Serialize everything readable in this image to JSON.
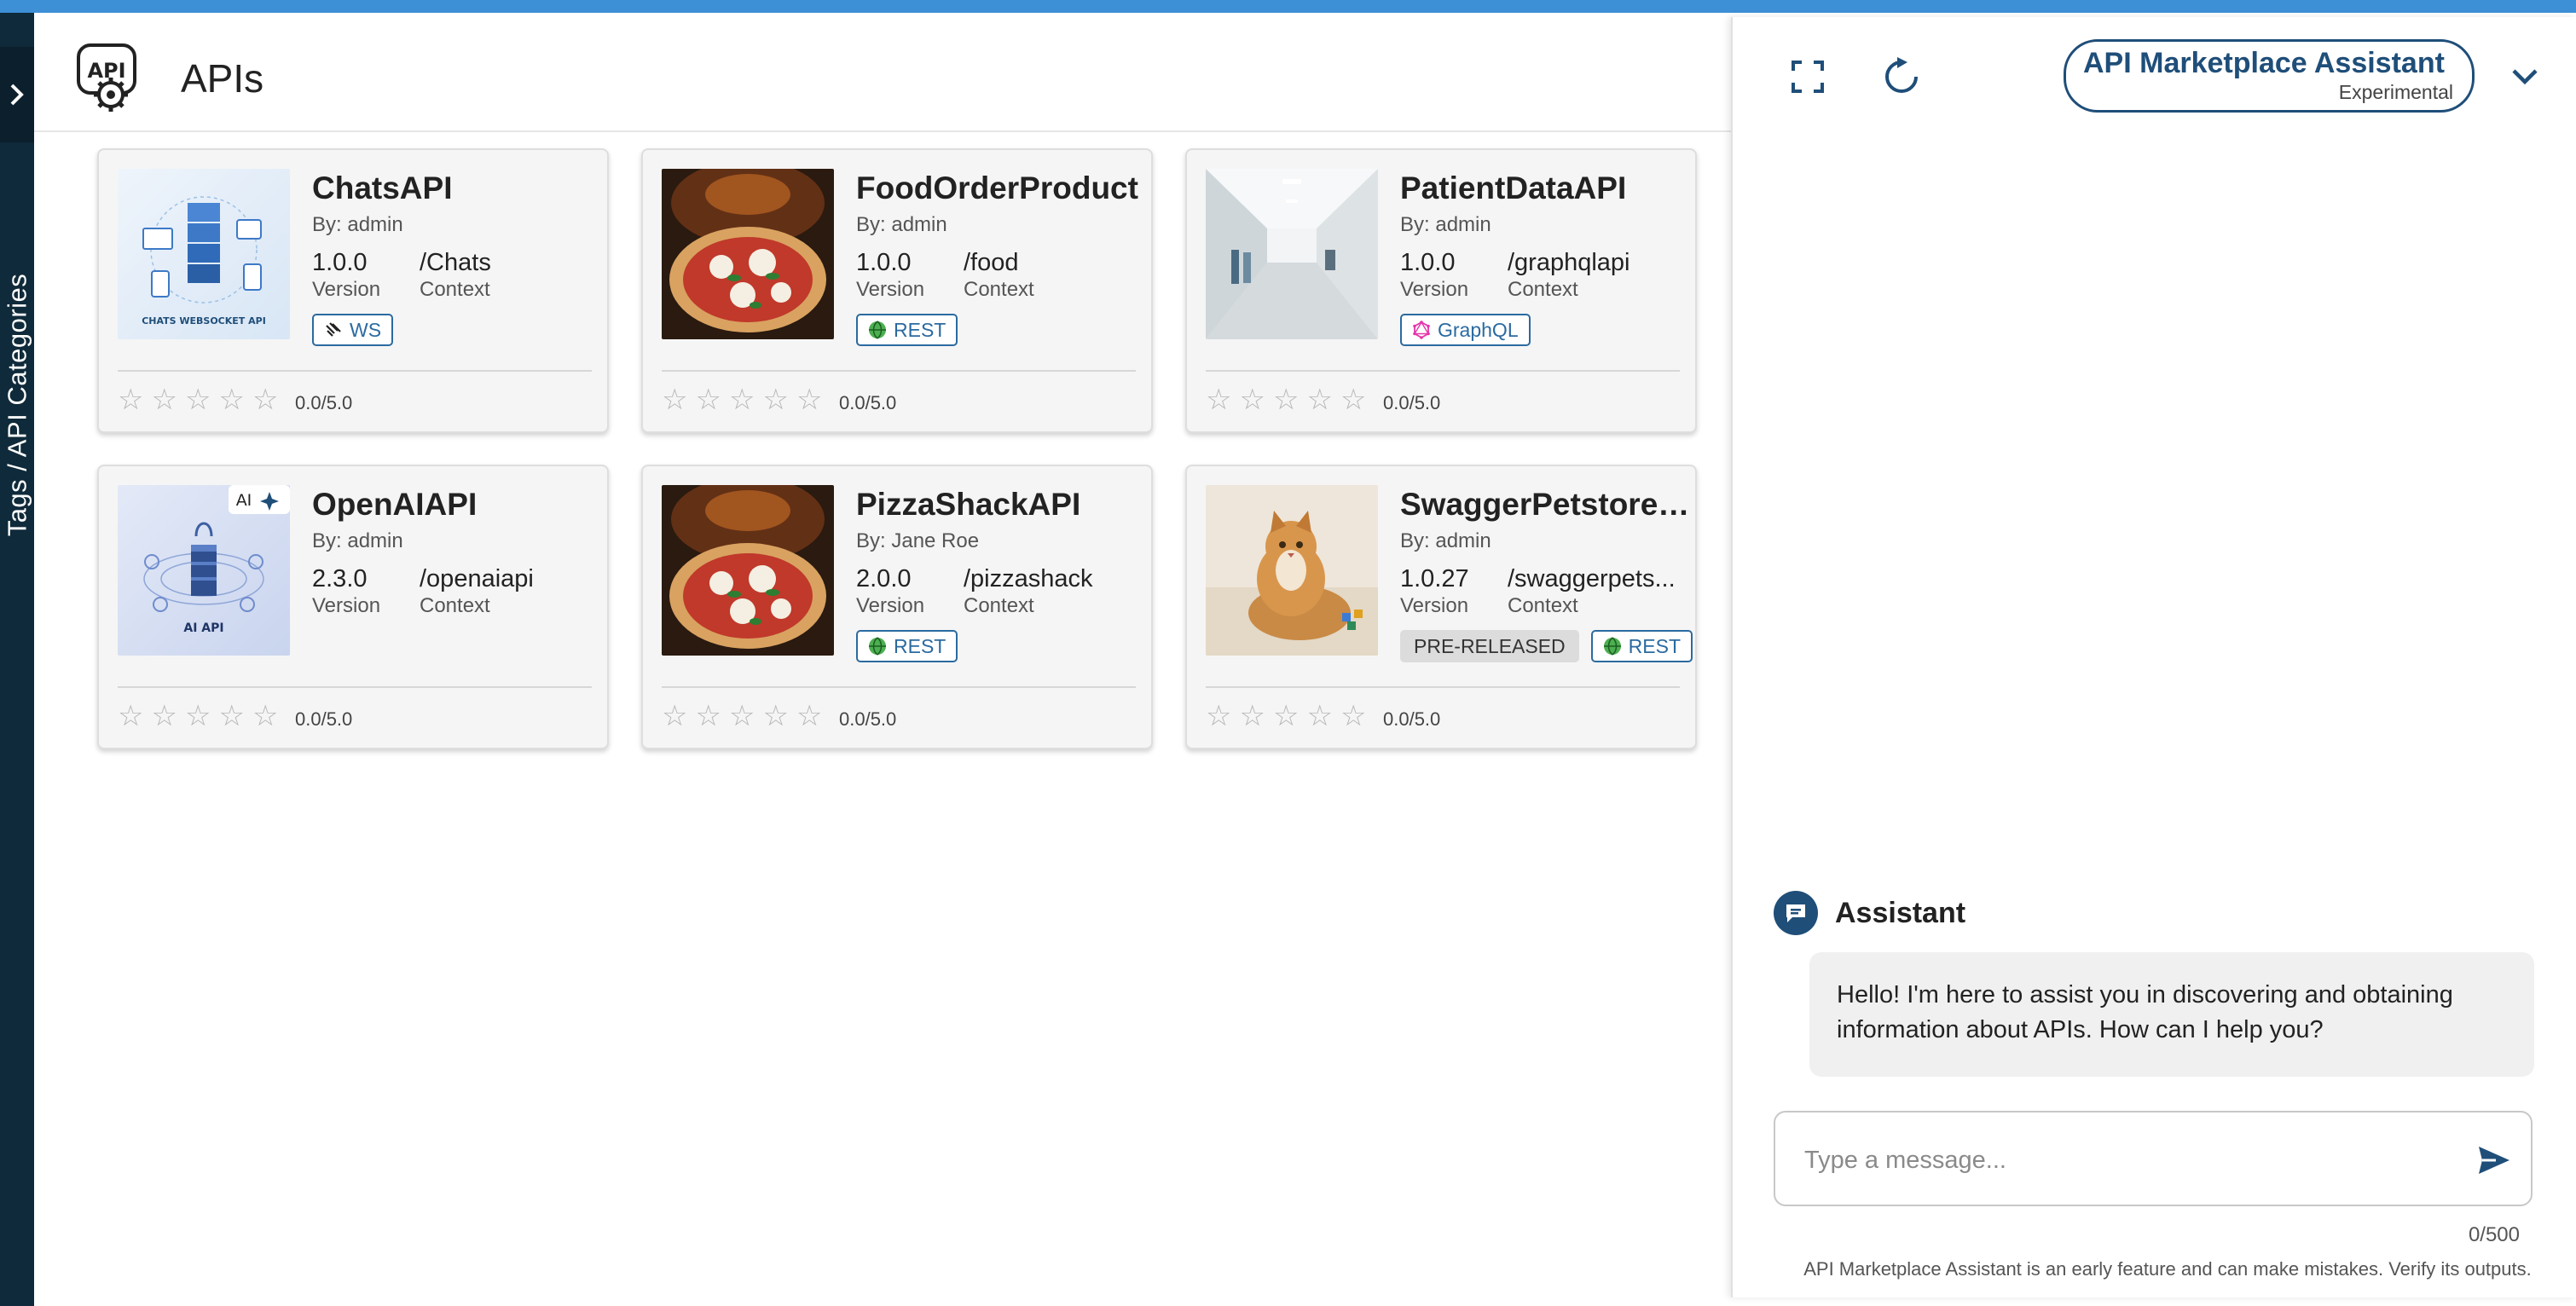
{
  "colors": {
    "accent_top": "#3d8fd6",
    "sidebar": "#0f2a3a",
    "brand_blue": "#1f4e79",
    "tag_blue": "#2b6aa0"
  },
  "sidebar": {
    "toggle_icon": "chevron-right-icon",
    "label": "Tags / API Categories"
  },
  "header": {
    "logo_text": "API",
    "title": "APIs"
  },
  "apis": [
    {
      "name": "ChatsAPI",
      "by": "By: admin",
      "version": "1.0.0",
      "version_label": "Version",
      "context": "/Chats",
      "context_label": "Context",
      "thumb": "chats-websocket",
      "thumb_caption": "CHATS WEBSOCKET API",
      "tags": [
        {
          "label": "WS",
          "icon": "websocket-icon"
        }
      ],
      "rating": "0.0/5.0",
      "stars": 0
    },
    {
      "name": "FoodOrderProduct",
      "by": "By: admin",
      "version": "1.0.0",
      "version_label": "Version",
      "context": "/food",
      "context_label": "Context",
      "thumb": "pizza",
      "tags": [
        {
          "label": "REST",
          "icon": "globe-icon"
        }
      ],
      "rating": "0.0/5.0",
      "stars": 0
    },
    {
      "name": "PatientDataAPI",
      "by": "By: admin",
      "version": "1.0.0",
      "version_label": "Version",
      "context": "/graphqlapi",
      "context_label": "Context",
      "thumb": "hospital",
      "tags": [
        {
          "label": "GraphQL",
          "icon": "graphql-icon"
        }
      ],
      "rating": "0.0/5.0",
      "stars": 0
    },
    {
      "name": "OpenAIAPI",
      "by": "By: admin",
      "version": "2.3.0",
      "version_label": "Version",
      "context": "/openaiapi",
      "context_label": "Context",
      "thumb": "ai-api",
      "thumb_caption": "AI API",
      "thumb_badge": "AI",
      "tags": [],
      "rating": "0.0/5.0",
      "stars": 0
    },
    {
      "name": "PizzaShackAPI",
      "by": "By: Jane Roe",
      "version": "2.0.0",
      "version_label": "Version",
      "context": "/pizzashack",
      "context_label": "Context",
      "thumb": "pizza",
      "tags": [
        {
          "label": "REST",
          "icon": "globe-icon"
        }
      ],
      "rating": "0.0/5.0",
      "stars": 0
    },
    {
      "name": "SwaggerPetstore-...",
      "by": "By: admin",
      "version": "1.0.27",
      "version_label": "Version",
      "context": "/swaggerpets...",
      "context_label": "Context",
      "thumb": "cat",
      "tags": [
        {
          "label": "PRE-RELEASED",
          "icon": "",
          "kind": "status"
        },
        {
          "label": "REST",
          "icon": "globe-icon"
        }
      ],
      "rating": "0.0/5.0",
      "stars": 0
    }
  ],
  "assistant": {
    "expand_icon": "fullscreen-icon",
    "reset_icon": "refresh-icon",
    "brand_title": "API Marketplace Assistant",
    "brand_subtitle": "Experimental",
    "collapse_icon": "chevron-down-icon",
    "sender": "Assistant",
    "message": "Hello! I'm here to assist you in discovering and obtaining information about APIs. How can I help you?",
    "input_value": "",
    "input_placeholder": "Type a message...",
    "send_icon": "send-icon",
    "counter": "0/500",
    "disclaimer": "API Marketplace Assistant is an early feature and can make mistakes. Verify its outputs."
  }
}
